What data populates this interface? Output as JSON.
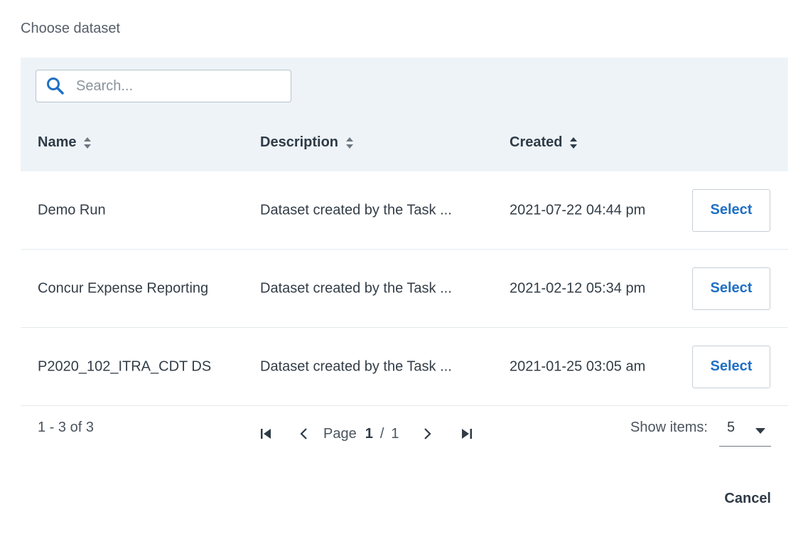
{
  "dialog": {
    "title": "Choose dataset"
  },
  "search": {
    "placeholder": "Search...",
    "value": ""
  },
  "table": {
    "columns": [
      "Name",
      "Description",
      "Created"
    ],
    "rows": [
      {
        "name": "Demo Run",
        "description": "Dataset created by the Task ...",
        "created": "2021-07-22 04:44 pm",
        "action": "Select"
      },
      {
        "name": "Concur Expense Reporting",
        "description": "Dataset created by the Task ...",
        "created": "2021-02-12 05:34 pm",
        "action": "Select"
      },
      {
        "name": "P2020_102_ITRA_CDT DS",
        "description": "Dataset created by the Task ...",
        "created": "2021-01-25 03:05 am",
        "action": "Select"
      }
    ]
  },
  "pagination": {
    "range": "1 - 3 of 3",
    "page_label": "Page",
    "current_page": "1",
    "separator": "/",
    "total_pages": "1",
    "show_items_label": "Show items:",
    "items_per_page": "5"
  },
  "footer": {
    "cancel_label": "Cancel"
  },
  "colors": {
    "accent": "#1f6fc5",
    "header_bg": "#eef3f8"
  },
  "icons": [
    "search-icon",
    "sort-icon",
    "first-page-icon",
    "prev-page-icon",
    "next-page-icon",
    "last-page-icon",
    "chevron-down-icon"
  ]
}
